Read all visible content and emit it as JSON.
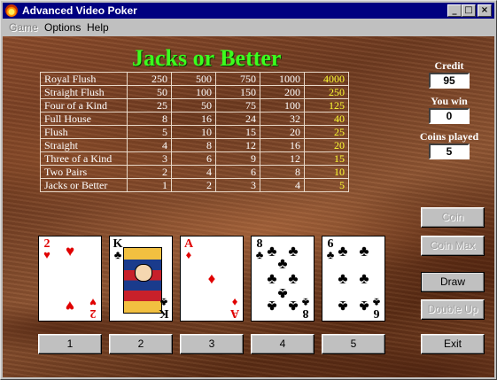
{
  "window": {
    "title": "Advanced Video Poker",
    "min_glyph": "_",
    "max_glyph": "□",
    "close_glyph": "×"
  },
  "menu": {
    "game": "Game",
    "options": "Options",
    "help": "Help"
  },
  "game_title": "Jacks or Better",
  "paytable": [
    {
      "hand": "Royal Flush",
      "payouts": [
        "250",
        "500",
        "750",
        "1000",
        "4000"
      ]
    },
    {
      "hand": "Straight Flush",
      "payouts": [
        "50",
        "100",
        "150",
        "200",
        "250"
      ]
    },
    {
      "hand": "Four of a Kind",
      "payouts": [
        "25",
        "50",
        "75",
        "100",
        "125"
      ]
    },
    {
      "hand": "Full House",
      "payouts": [
        "8",
        "16",
        "24",
        "32",
        "40"
      ]
    },
    {
      "hand": "Flush",
      "payouts": [
        "5",
        "10",
        "15",
        "20",
        "25"
      ]
    },
    {
      "hand": "Straight",
      "payouts": [
        "4",
        "8",
        "12",
        "16",
        "20"
      ]
    },
    {
      "hand": "Three of a Kind",
      "payouts": [
        "3",
        "6",
        "9",
        "12",
        "15"
      ]
    },
    {
      "hand": "Two Pairs",
      "payouts": [
        "2",
        "4",
        "6",
        "8",
        "10"
      ]
    },
    {
      "hand": "Jacks or Better",
      "payouts": [
        "1",
        "2",
        "3",
        "4",
        "5"
      ]
    }
  ],
  "side": {
    "credit_label": "Credit",
    "credit_value": "95",
    "win_label": "You win",
    "win_value": "0",
    "coins_label": "Coins played",
    "coins_value": "5"
  },
  "buttons": {
    "coin": "Coin",
    "coin_max": "Coin Max",
    "draw": "Draw",
    "double_up": "Double Up",
    "exit": "Exit"
  },
  "cards": [
    {
      "rank": "2",
      "suit": "♥",
      "color": "#e00000",
      "center": "",
      "pips": "♥ ♥"
    },
    {
      "rank": "K",
      "suit": "♣",
      "color": "#000000",
      "center": "K",
      "pips": ""
    },
    {
      "rank": "A",
      "suit": "♦",
      "color": "#e00000",
      "center": "♦",
      "pips": ""
    },
    {
      "rank": "8",
      "suit": "♣",
      "color": "#000000",
      "center": "",
      "pips": "8 clubs"
    },
    {
      "rank": "6",
      "suit": "♣",
      "color": "#000000",
      "center": "",
      "pips": "6 clubs"
    }
  ],
  "hold_buttons": [
    "1",
    "2",
    "3",
    "4",
    "5"
  ],
  "colors": {
    "titlebar": "#000080",
    "felt": "#7a4224",
    "title_green": "#3cff1e",
    "highlight_yellow": "#ffff33"
  }
}
